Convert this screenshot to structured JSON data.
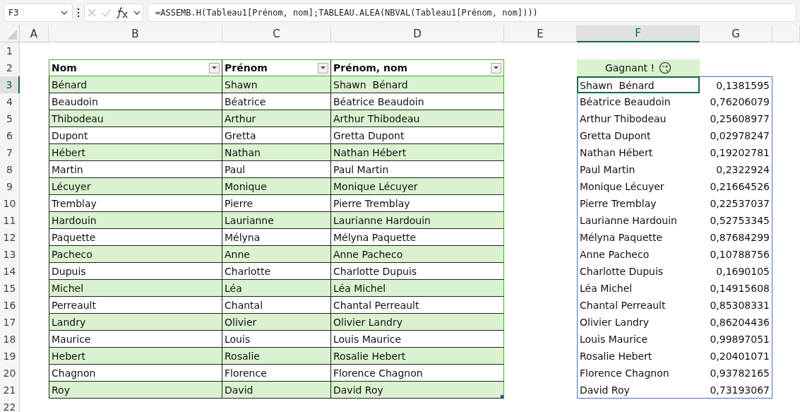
{
  "name_box": "F3",
  "formula": "=ASSEMB.H(Tableau1[Prénom, nom];TABLEAU.ALEA(NBVAL(Tableau1[Prénom, nom])))",
  "columns": [
    {
      "label": "A",
      "selected": false
    },
    {
      "label": "B",
      "selected": false
    },
    {
      "label": "C",
      "selected": false
    },
    {
      "label": "D",
      "selected": false
    },
    {
      "label": "E",
      "selected": false
    },
    {
      "label": "F",
      "selected": true
    },
    {
      "label": "G",
      "selected": false
    }
  ],
  "row_numbers": [
    {
      "label": "1",
      "selected": false
    },
    {
      "label": "2",
      "selected": false
    },
    {
      "label": "3",
      "selected": true
    },
    {
      "label": "4",
      "selected": false
    },
    {
      "label": "5",
      "selected": false
    },
    {
      "label": "6",
      "selected": false
    },
    {
      "label": "7",
      "selected": false
    },
    {
      "label": "8",
      "selected": false
    },
    {
      "label": "9",
      "selected": false
    },
    {
      "label": "10",
      "selected": false
    },
    {
      "label": "11",
      "selected": false
    },
    {
      "label": "12",
      "selected": false
    },
    {
      "label": "13",
      "selected": false
    },
    {
      "label": "14",
      "selected": false
    },
    {
      "label": "15",
      "selected": false
    },
    {
      "label": "16",
      "selected": false
    },
    {
      "label": "17",
      "selected": false
    },
    {
      "label": "18",
      "selected": false
    },
    {
      "label": "19",
      "selected": false
    },
    {
      "label": "20",
      "selected": false
    },
    {
      "label": "21",
      "selected": false
    },
    {
      "label": "22",
      "selected": false
    }
  ],
  "table": {
    "headers": [
      "Nom",
      "Prénom",
      "Prénom, nom"
    ],
    "rows": [
      [
        "Bénard",
        "Shawn",
        "Shawn  Bénard"
      ],
      [
        "Beaudoin",
        "Béatrice",
        "Béatrice Beaudoin"
      ],
      [
        "Thibodeau",
        "Arthur",
        "Arthur Thibodeau"
      ],
      [
        "Dupont",
        "Gretta",
        "Gretta Dupont"
      ],
      [
        "Hébert",
        "Nathan",
        "Nathan Hébert"
      ],
      [
        "Martin",
        "Paul",
        "Paul Martin"
      ],
      [
        "Lécuyer",
        "Monique",
        "Monique Lécuyer"
      ],
      [
        "Tremblay",
        "Pierre",
        "Pierre Tremblay"
      ],
      [
        "Hardouin",
        "Laurianne",
        "Laurianne Hardouin"
      ],
      [
        "Paquette",
        "Mélyna",
        "Mélyna Paquette"
      ],
      [
        "Pacheco",
        "Anne",
        "Anne Pacheco"
      ],
      [
        "Dupuis",
        "Charlotte",
        "Charlotte Dupuis"
      ],
      [
        "Michel",
        "Léa",
        "Léa Michel"
      ],
      [
        "Perreault",
        "Chantal",
        "Chantal Perreault"
      ],
      [
        "Landry",
        "Olivier",
        "Olivier Landry"
      ],
      [
        "Maurice",
        "Louis",
        "Louis Maurice"
      ],
      [
        "Hebert",
        "Rosalie",
        "Rosalie Hebert"
      ],
      [
        "Chagnon",
        "Florence",
        "Florence Chagnon"
      ],
      [
        "Roy",
        "David",
        "David Roy"
      ]
    ]
  },
  "winner": {
    "header": "Gagnant !",
    "rows": [
      [
        "Shawn  Bénard",
        "0,1381595"
      ],
      [
        "Béatrice Beaudoin",
        "0,76206079"
      ],
      [
        "Arthur Thibodeau",
        "0,25608977"
      ],
      [
        "Gretta Dupont",
        "0,02978247"
      ],
      [
        "Nathan Hébert",
        "0,19202781"
      ],
      [
        "Paul Martin",
        "0,2322924"
      ],
      [
        "Monique Lécuyer",
        "0,21664526"
      ],
      [
        "Pierre Tremblay",
        "0,22537037"
      ],
      [
        "Laurianne Hardouin",
        "0,52753345"
      ],
      [
        "Mélyna Paquette",
        "0,87684299"
      ],
      [
        "Anne Pacheco",
        "0,10788756"
      ],
      [
        "Charlotte Dupuis",
        "0,1690105"
      ],
      [
        "Léa Michel",
        "0,14915608"
      ],
      [
        "Chantal Perreault",
        "0,85308331"
      ],
      [
        "Olivier Landry",
        "0,86204436"
      ],
      [
        "Louis Maurice",
        "0,99897051"
      ],
      [
        "Rosalie Hebert",
        "0,20401071"
      ],
      [
        "Florence Chagnon",
        "0,93782165"
      ],
      [
        "David Roy",
        "0,73193067"
      ]
    ]
  }
}
